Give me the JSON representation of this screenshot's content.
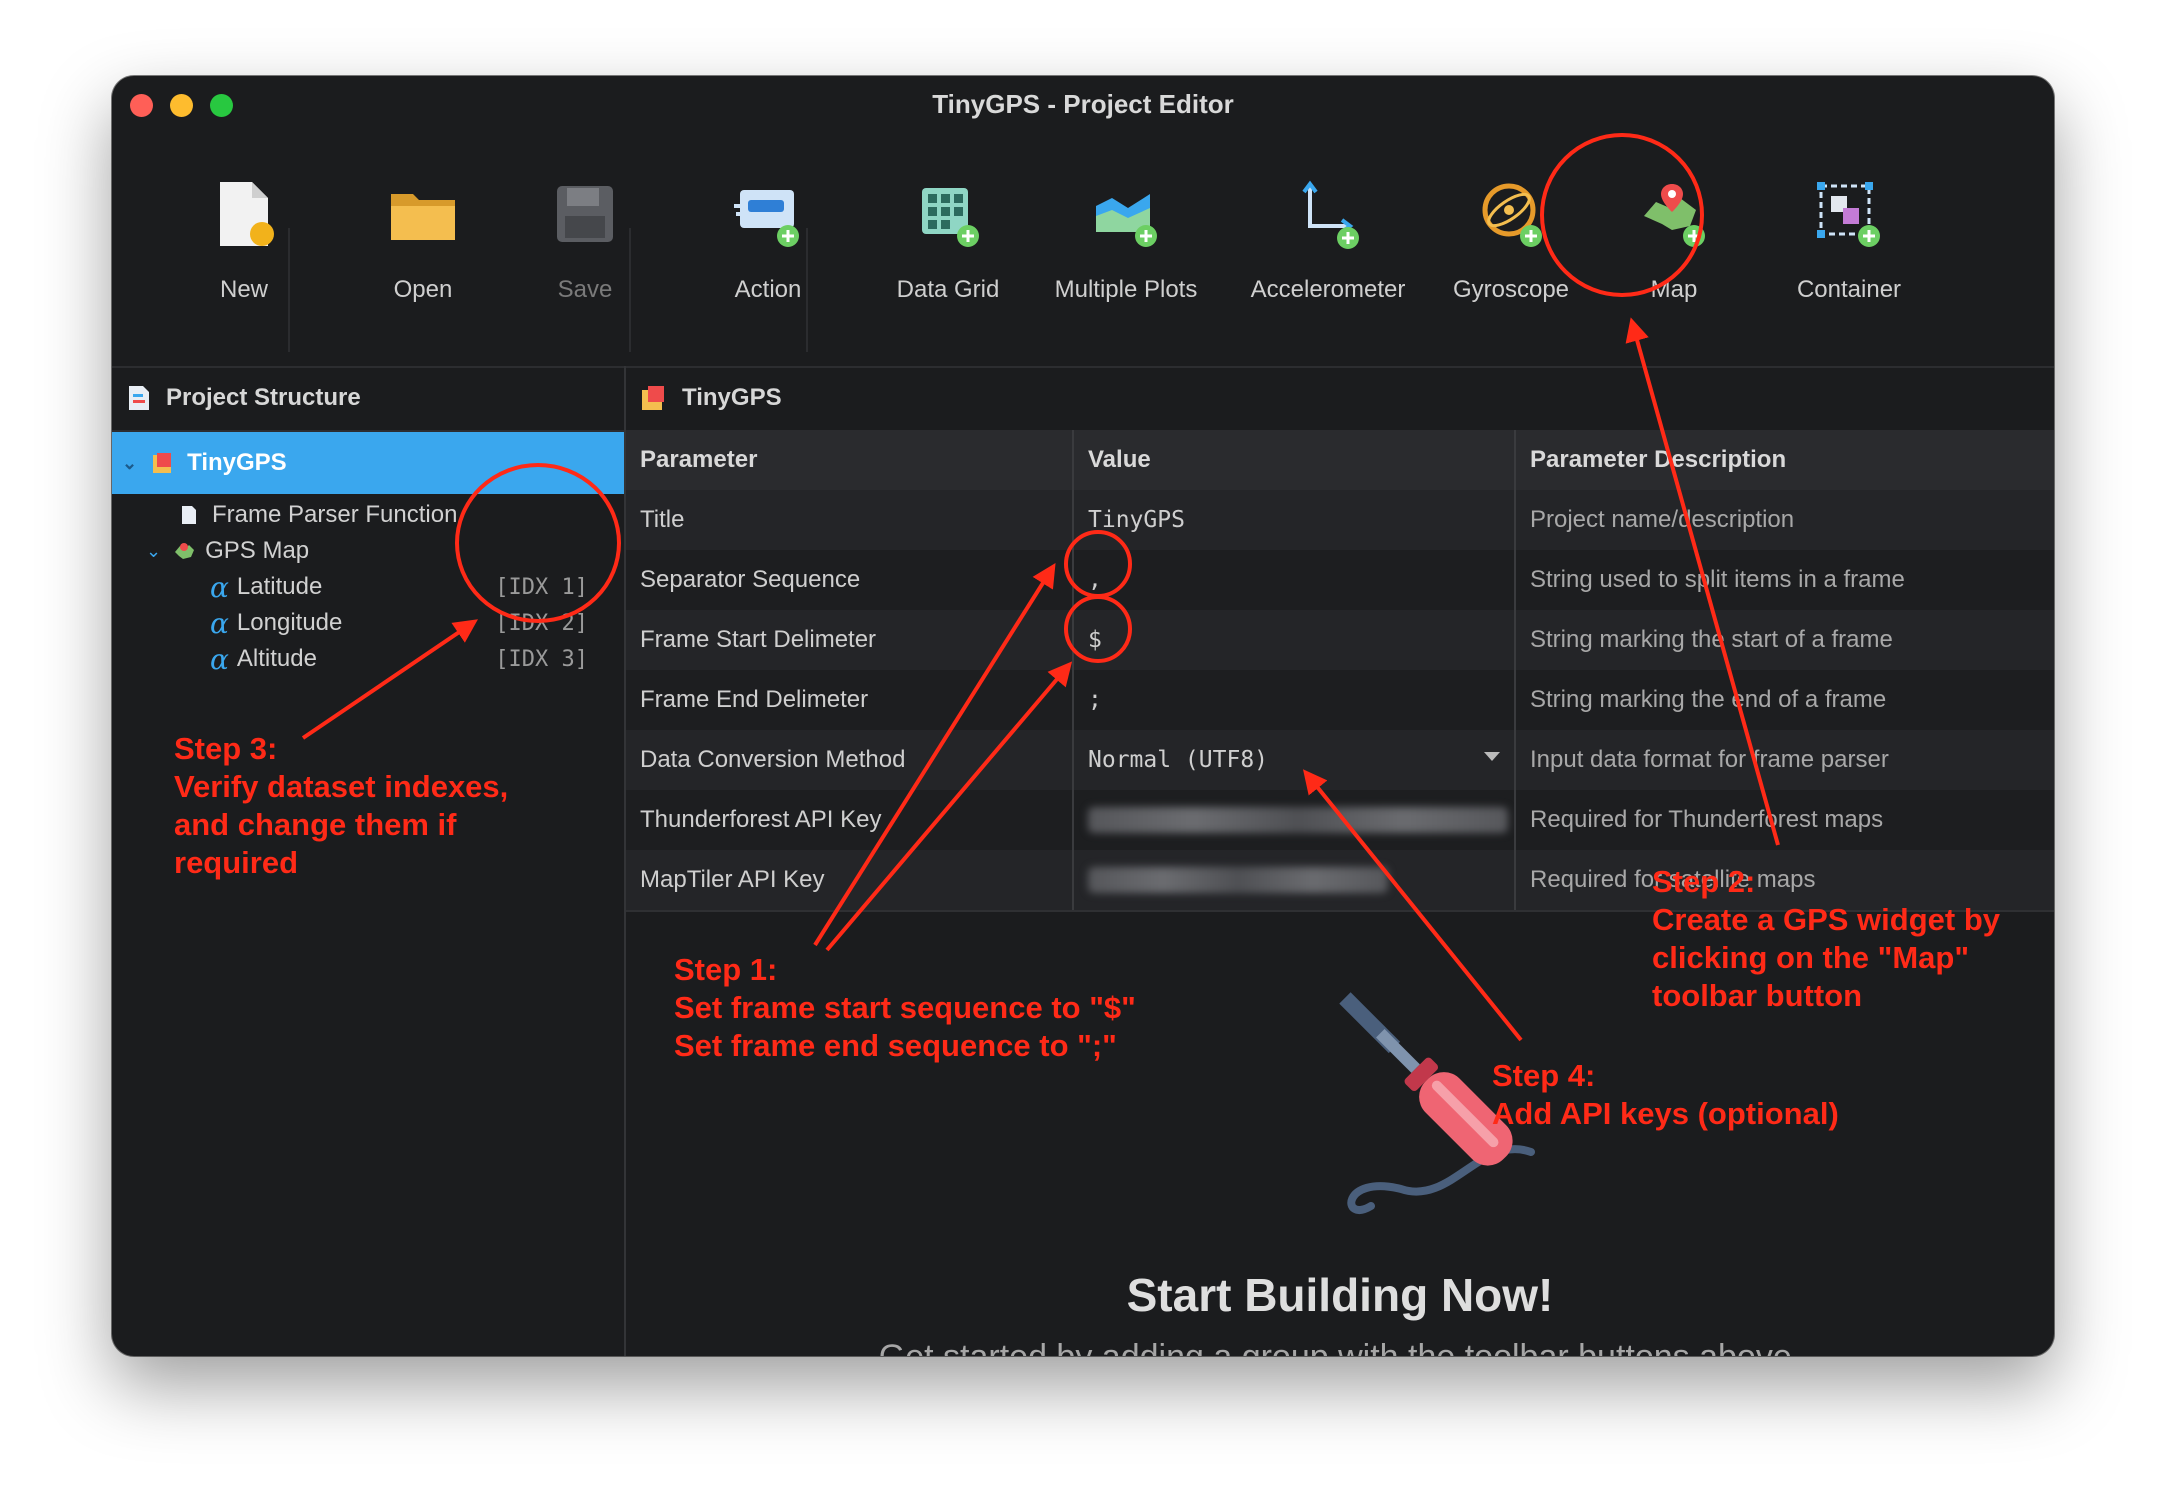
{
  "window": {
    "title": "TinyGPS - Project Editor"
  },
  "toolbar": {
    "buttons": [
      {
        "label": "New",
        "icon": "new-document-icon",
        "enabled": true
      },
      {
        "label": "Open",
        "icon": "folder-icon",
        "enabled": true
      },
      {
        "label": "Save",
        "icon": "floppy-disk-icon",
        "enabled": false
      },
      {
        "label": "Action",
        "icon": "action-icon",
        "enabled": true
      },
      {
        "label": "Data Grid",
        "icon": "data-grid-icon",
        "enabled": true
      },
      {
        "label": "Multiple Plots",
        "icon": "multiple-plots-icon",
        "enabled": true
      },
      {
        "label": "Accelerometer",
        "icon": "accelerometer-icon",
        "enabled": true
      },
      {
        "label": "Gyroscope",
        "icon": "gyroscope-icon",
        "enabled": true
      },
      {
        "label": "Map",
        "icon": "map-icon",
        "enabled": true
      },
      {
        "label": "Container",
        "icon": "container-icon",
        "enabled": true
      }
    ]
  },
  "project_structure": {
    "title": "Project Structure",
    "root": "TinyGPS",
    "items": [
      {
        "label": "Frame Parser Function"
      },
      {
        "label": "GPS Map"
      },
      {
        "label": "Latitude",
        "index": "[IDX 1]"
      },
      {
        "label": "Longitude",
        "index": "[IDX 2]"
      },
      {
        "label": "Altitude",
        "index": "[IDX 3]"
      }
    ]
  },
  "editor": {
    "title": "TinyGPS",
    "columns": [
      "Parameter",
      "Value",
      "Parameter Description"
    ],
    "rows": [
      {
        "param": "Title",
        "value": "TinyGPS",
        "desc": "Project name/description"
      },
      {
        "param": "Separator Sequence",
        "value": ",",
        "desc": "String used to split items in a frame"
      },
      {
        "param": "Frame Start Delimeter",
        "value": "$",
        "desc": "String marking the start of a frame"
      },
      {
        "param": "Frame End Delimeter",
        "value": ";",
        "desc": "String marking the end of a frame"
      },
      {
        "param": "Data Conversion Method",
        "value": "Normal (UTF8)",
        "desc": "Input data format for frame parser"
      },
      {
        "param": "Thunderforest API Key",
        "value": "",
        "desc": "Required for Thunderforest maps"
      },
      {
        "param": "MapTiler API Key",
        "value": "",
        "desc": "Required for satellite maps"
      }
    ],
    "empty_title": "Start Building Now!",
    "empty_subtitle": "Get started by adding a group with the toolbar buttons above."
  },
  "annotations": {
    "color": "#ff2a17",
    "step1": [
      "Step 1:",
      "Set frame start sequence to \"$\"",
      "Set frame end sequence to \";\""
    ],
    "step2": [
      "Step 2:",
      "Create a GPS widget by",
      "clicking on the \"Map\"",
      "toolbar button"
    ],
    "step3": [
      "Step 3:",
      "Verify dataset indexes,",
      "and change them if",
      "required"
    ],
    "step4": [
      "Step 4:",
      "Add API keys (optional)"
    ]
  },
  "colors": {
    "selection": "#3aa7ee",
    "window_bg": "#1b1c1e"
  }
}
